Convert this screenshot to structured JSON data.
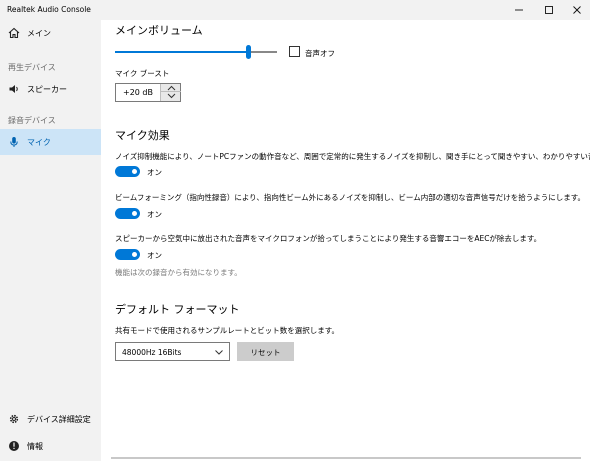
{
  "window": {
    "title": "Realtek Audio Console"
  },
  "sidebar": {
    "items": [
      {
        "label": "メイン",
        "icon": "home-icon"
      },
      {
        "label": "スピーカー",
        "icon": "speaker-icon"
      },
      {
        "label": "マイク",
        "icon": "microphone-icon",
        "selected": true
      }
    ],
    "sections": {
      "playback": "再生デバイス",
      "recording": "録音デバイス"
    },
    "footer": [
      {
        "label": "デバイス詳細設定",
        "icon": "gear-icon"
      },
      {
        "label": "情報",
        "icon": "info-icon"
      }
    ]
  },
  "main": {
    "volume": {
      "title": "メインボリューム",
      "level": 0.82,
      "mute_label": "音声オフ",
      "muted": false
    },
    "boost": {
      "label": "マイク ブースト",
      "value": "+20 dB"
    },
    "effects": {
      "title": "マイク効果",
      "items": [
        {
          "description": "ノイズ抑制機能により、ノートPCファンの動作音など、周囲で定常的に発生するノイズを抑制し、聞き手にとって聞きやすい、わかりやすい音声と",
          "state": "オン"
        },
        {
          "description": "ビームフォーミング（指向性録音）により、指向性ビーム外にあるノイズを抑制し、ビーム内部の適切な音声信号だけを拾うようにします。",
          "state": "オン"
        },
        {
          "description": "スピーカーから空気中に放出された音声をマイクロフォンが拾ってしまうことにより発生する音響エコーをAECが除去します。",
          "state": "オン"
        }
      ],
      "note": "機能は次の録音から有効になります。"
    },
    "format": {
      "title": "デフォルト フォーマット",
      "description": "共有モードで使用されるサンプルレートとビット数を選択します。",
      "selected": "48000Hz 16Bits",
      "reset_label": "リセット"
    }
  },
  "colors": {
    "accent": "#0078d7",
    "selected_bg": "#cce4f7",
    "sidebar_bg": "#f2f2f2"
  }
}
